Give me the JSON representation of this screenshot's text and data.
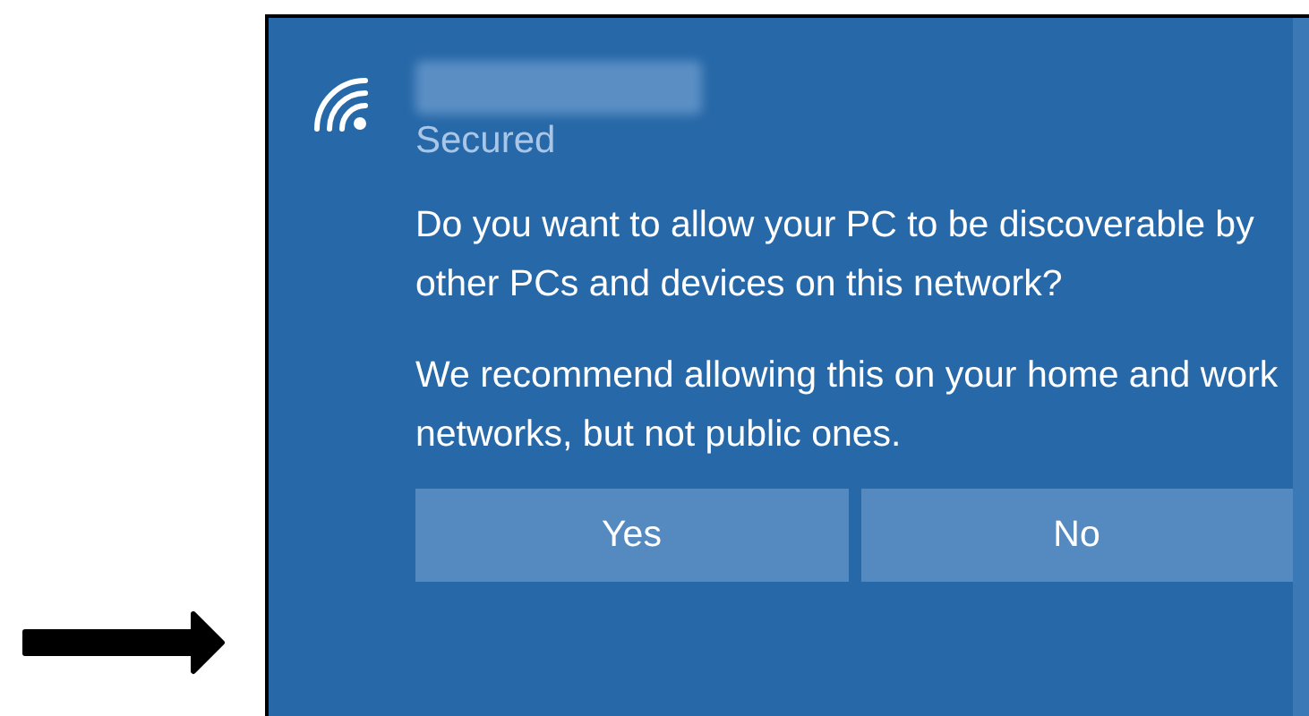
{
  "network": {
    "status": "Secured"
  },
  "messages": [
    "Do you want to allow your PC to be discoverable by other PCs and devices on this network?",
    "We recommend allowing this on your home and work networks, but not public ones."
  ],
  "buttons": [
    "Yes",
    "No"
  ]
}
